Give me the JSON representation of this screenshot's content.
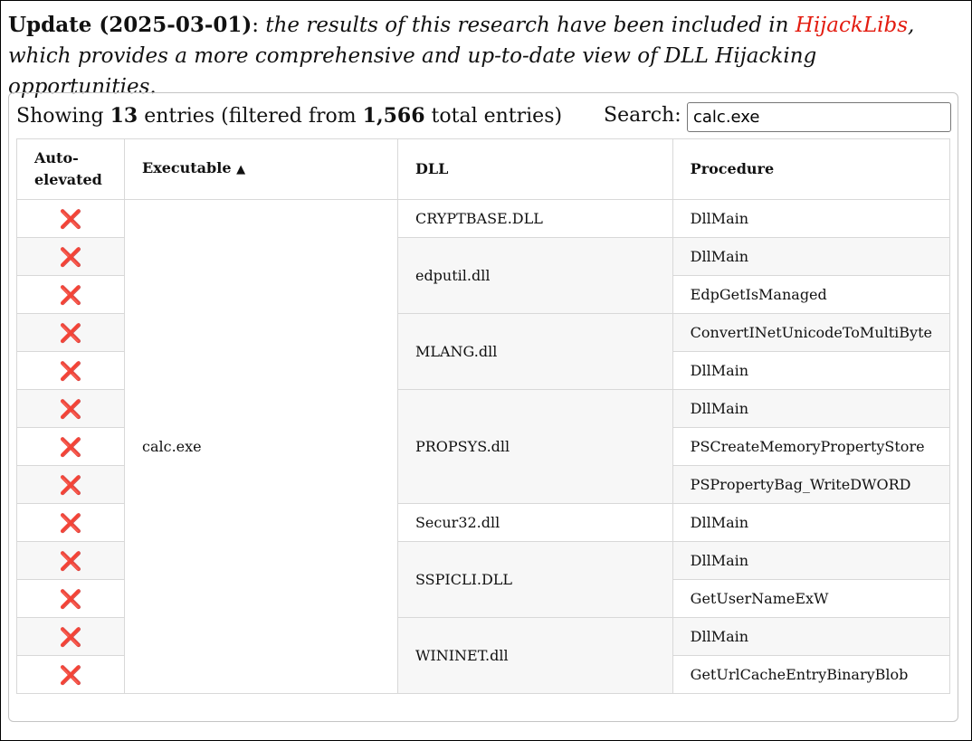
{
  "notice": {
    "label": "Update (2025-03-01)",
    "colon": ":",
    "text_before": " the results of this research have been included in ",
    "link": "HijackLibs",
    "text_after": ", which provides a more comprehensive and up-to-date view of DLL Hijacking opportunities."
  },
  "info": {
    "prefix": "Showing ",
    "count": "13",
    "middle": " entries (filtered from ",
    "total": "1,566",
    "suffix": " total entries)"
  },
  "search": {
    "label": "Search:",
    "value": "calc.exe"
  },
  "columns": {
    "auto_elevated": "Auto-elevated",
    "executable": "Executable",
    "dll": "DLL",
    "procedure": "Procedure"
  },
  "icons": {
    "sort": "sort-ascending-icon",
    "no": "red-x-icon"
  },
  "colors": {
    "link": "#e31b0f",
    "x_mark": "#e03131",
    "stripe": "#f7f7f7"
  },
  "executable": "calc.exe",
  "dll_groups": [
    {
      "name": "CRYPTBASE.DLL",
      "rows": 1
    },
    {
      "name": "edputil.dll",
      "rows": 2
    },
    {
      "name": "MLANG.dll",
      "rows": 2
    },
    {
      "name": "PROPSYS.dll",
      "rows": 3
    },
    {
      "name": "Secur32.dll",
      "rows": 1
    },
    {
      "name": "SSPICLI.DLL",
      "rows": 2
    },
    {
      "name": "WININET.dll",
      "rows": 2
    }
  ],
  "rows": [
    {
      "auto_elevated": "❌",
      "procedure": "DllMain"
    },
    {
      "auto_elevated": "❌",
      "procedure": "DllMain"
    },
    {
      "auto_elevated": "❌",
      "procedure": "EdpGetIsManaged"
    },
    {
      "auto_elevated": "❌",
      "procedure": "ConvertINetUnicodeToMultiByte"
    },
    {
      "auto_elevated": "❌",
      "procedure": "DllMain"
    },
    {
      "auto_elevated": "❌",
      "procedure": "DllMain"
    },
    {
      "auto_elevated": "❌",
      "procedure": "PSCreateMemoryPropertyStore"
    },
    {
      "auto_elevated": "❌",
      "procedure": "PSPropertyBag_WriteDWORD"
    },
    {
      "auto_elevated": "❌",
      "procedure": "DllMain"
    },
    {
      "auto_elevated": "❌",
      "procedure": "DllMain"
    },
    {
      "auto_elevated": "❌",
      "procedure": "GetUserNameExW"
    },
    {
      "auto_elevated": "❌",
      "procedure": "DllMain"
    },
    {
      "auto_elevated": "❌",
      "procedure": "GetUrlCacheEntryBinaryBlob"
    }
  ]
}
